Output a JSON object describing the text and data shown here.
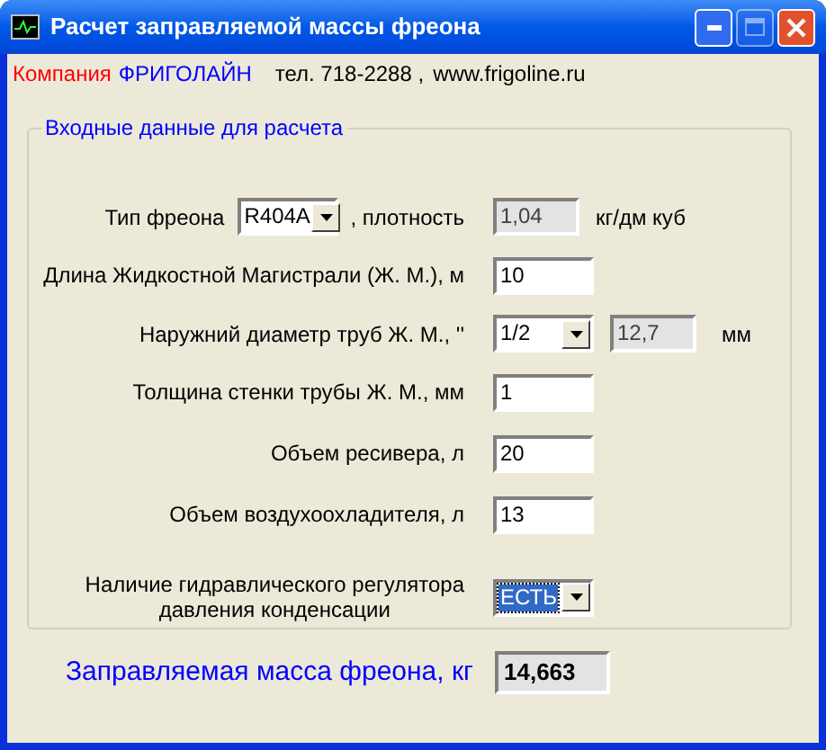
{
  "window": {
    "title": "Расчет заправляемой массы фреона",
    "controls": [
      {
        "kind": "minimize",
        "disabled": false
      },
      {
        "kind": "maximize",
        "disabled": true
      },
      {
        "kind": "close",
        "disabled": false
      }
    ]
  },
  "header": {
    "company_label": "Компания",
    "company_name": "ФРИГОЛАЙН",
    "phone": "тел. 718-2288 ,",
    "website": "www.frigoline.ru"
  },
  "group": {
    "legend": "Входные данные для расчета",
    "rows": [
      {
        "kind": "combo_density",
        "label": "Тип фреона",
        "value": "R404A",
        "label2": ", плотность",
        "readout": "1,04",
        "unit": "кг/дм куб"
      },
      {
        "kind": "input",
        "label": "Длина Жидкостной Магистрали (Ж. М.), м",
        "value": "10"
      },
      {
        "kind": "combo_readout",
        "label": "Наружний диаметр труб Ж. М., ''",
        "value": "1/2",
        "readout": "12,7",
        "unit": "мм"
      },
      {
        "kind": "input",
        "label": "Толщина стенки трубы Ж. М., мм",
        "value": "1"
      },
      {
        "kind": "input",
        "label": "Объем ресивера, л",
        "value": "20"
      },
      {
        "kind": "input",
        "label": "Объем воздухоохладителя, л",
        "value": "13"
      },
      {
        "kind": "combo",
        "label_lines": [
          "Наличие гидравлического регулятора",
          "давления конденсации"
        ],
        "value": "ЕСТЬ",
        "focused": true
      }
    ]
  },
  "result": {
    "label": "Заправляемая масса фреона, кг",
    "value": "14,663"
  }
}
